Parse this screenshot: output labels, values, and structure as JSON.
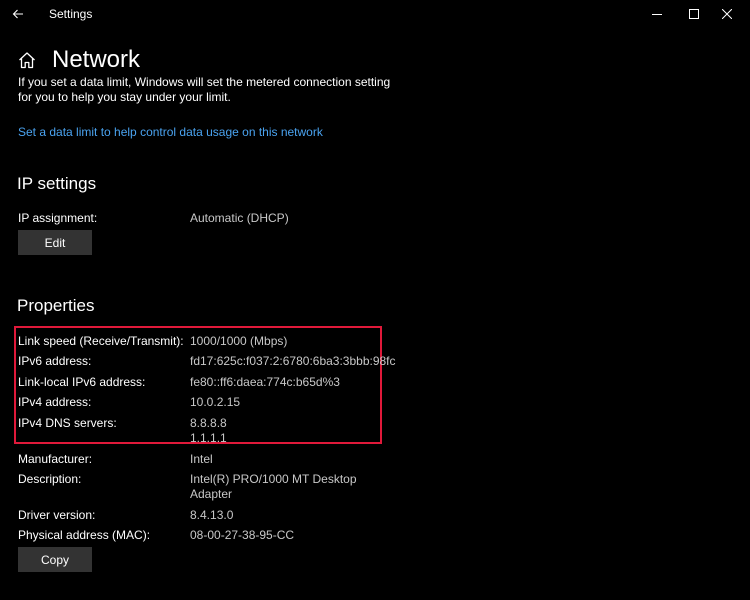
{
  "window": {
    "title": "Settings",
    "icons": {
      "back": "back-arrow-icon",
      "minimize": "minimize-icon",
      "maximize": "maximize-icon",
      "close": "close-icon"
    }
  },
  "header": {
    "title": "Network",
    "icon": "home-icon"
  },
  "data_limit": {
    "description": "If you set a data limit, Windows will set the metered connection setting for you to help you stay under your limit.",
    "link_text": "Set a data limit to help control data usage on this network",
    "link_color": "#4aa3f0"
  },
  "ip_settings": {
    "heading": "IP settings",
    "assignment_label": "IP assignment:",
    "assignment_value": "Automatic (DHCP)",
    "edit_label": "Edit"
  },
  "properties": {
    "heading": "Properties",
    "rows": [
      {
        "label": "Link speed (Receive/Transmit):",
        "value": "1000/1000 (Mbps)"
      },
      {
        "label": "IPv6 address:",
        "value": "fd17:625c:f037:2:6780:6ba3:3bbb:98fc"
      },
      {
        "label": "Link-local IPv6 address:",
        "value": "fe80::ff6:daea:774c:b65d%3"
      },
      {
        "label": "IPv4 address:",
        "value": "10.0.2.15"
      },
      {
        "label": "IPv4 DNS servers:",
        "value": "8.8.8.8",
        "value2": "1.1.1.1"
      },
      {
        "label": "Manufacturer:",
        "value": "Intel"
      },
      {
        "label": "Description:",
        "value": "Intel(R) PRO/1000 MT Desktop",
        "value2": "Adapter"
      },
      {
        "label": "Driver version:",
        "value": "8.4.13.0"
      },
      {
        "label": "Physical address (MAC):",
        "value": "08-00-27-38-95-CC"
      }
    ],
    "copy_label": "Copy"
  },
  "highlight_color": "#e0193a"
}
